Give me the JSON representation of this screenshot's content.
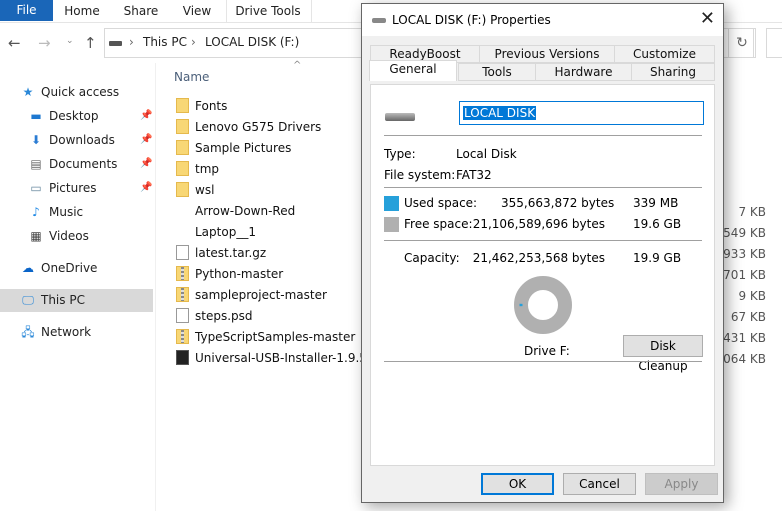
{
  "ribbon": {
    "tabs": [
      "File",
      "Home",
      "Share",
      "View",
      "Drive Tools"
    ]
  },
  "address": {
    "crumbs": [
      "This PC",
      "LOCAL DISK (F:)"
    ]
  },
  "sidebar": {
    "items": [
      {
        "label": "Quick access",
        "icon": "star-icon"
      },
      {
        "label": "Desktop",
        "icon": "desktop-icon",
        "pinned": true
      },
      {
        "label": "Downloads",
        "icon": "download-arrow-icon",
        "pinned": true
      },
      {
        "label": "Documents",
        "icon": "document-icon",
        "pinned": true
      },
      {
        "label": "Pictures",
        "icon": "pictures-icon",
        "pinned": true
      },
      {
        "label": "Music",
        "icon": "music-note-icon"
      },
      {
        "label": "Videos",
        "icon": "film-icon"
      },
      {
        "label": "OneDrive",
        "icon": "cloud-icon"
      },
      {
        "label": "This PC",
        "icon": "monitor-icon",
        "selected": true
      },
      {
        "label": "Network",
        "icon": "network-icon"
      }
    ]
  },
  "filelist": {
    "column_name": "Name",
    "files": [
      {
        "name": "Fonts",
        "type": "folder",
        "size": ""
      },
      {
        "name": "Lenovo G575 Drivers",
        "type": "folder",
        "size": ""
      },
      {
        "name": "Sample Pictures",
        "type": "folder",
        "size": ""
      },
      {
        "name": "tmp",
        "type": "folder",
        "size": ""
      },
      {
        "name": "wsl",
        "type": "folder",
        "size": ""
      },
      {
        "name": "Arrow-Down-Red",
        "type": "image",
        "size": "7 KB"
      },
      {
        "name": "Laptop__1",
        "type": "image",
        "size": "549 KB"
      },
      {
        "name": "latest.tar.gz",
        "type": "doc",
        "size": ",933 KB"
      },
      {
        "name": "Python-master",
        "type": "zip",
        "size": ",701 KB"
      },
      {
        "name": "sampleproject-master",
        "type": "zip",
        "size": "9 KB"
      },
      {
        "name": "steps.psd",
        "type": "doc",
        "size": "67 KB"
      },
      {
        "name": "TypeScriptSamples-master",
        "type": "zip",
        "size": "431 KB"
      },
      {
        "name": "Universal-USB-Installer-1.9.5.9",
        "type": "exe",
        "size": ",064 KB"
      }
    ]
  },
  "dialog": {
    "title": "LOCAL DISK (F:) Properties",
    "tabs_row1": [
      "ReadyBoost",
      "Previous Versions",
      "Customize"
    ],
    "tabs_row2": [
      "General",
      "Tools",
      "Hardware",
      "Sharing"
    ],
    "active_tab": "General",
    "volume_name": "LOCAL DISK",
    "type_label": "Type:",
    "type_value": "Local Disk",
    "fs_label": "File system:",
    "fs_value": "FAT32",
    "used_label": "Used space:",
    "used_bytes": "355,663,872 bytes",
    "used_human": "339 MB",
    "free_label": "Free space:",
    "free_bytes": "21,106,589,696 bytes",
    "free_human": "19.6 GB",
    "capacity_label": "Capacity:",
    "capacity_bytes": "21,462,253,568 bytes",
    "capacity_human": "19.9 GB",
    "drive_label": "Drive F:",
    "used_fraction": 0.0166,
    "used_color": "#26a0da",
    "free_color": "#b0b0b0",
    "disk_cleanup": "Disk Cleanup",
    "ok": "OK",
    "cancel": "Cancel",
    "apply": "Apply"
  }
}
